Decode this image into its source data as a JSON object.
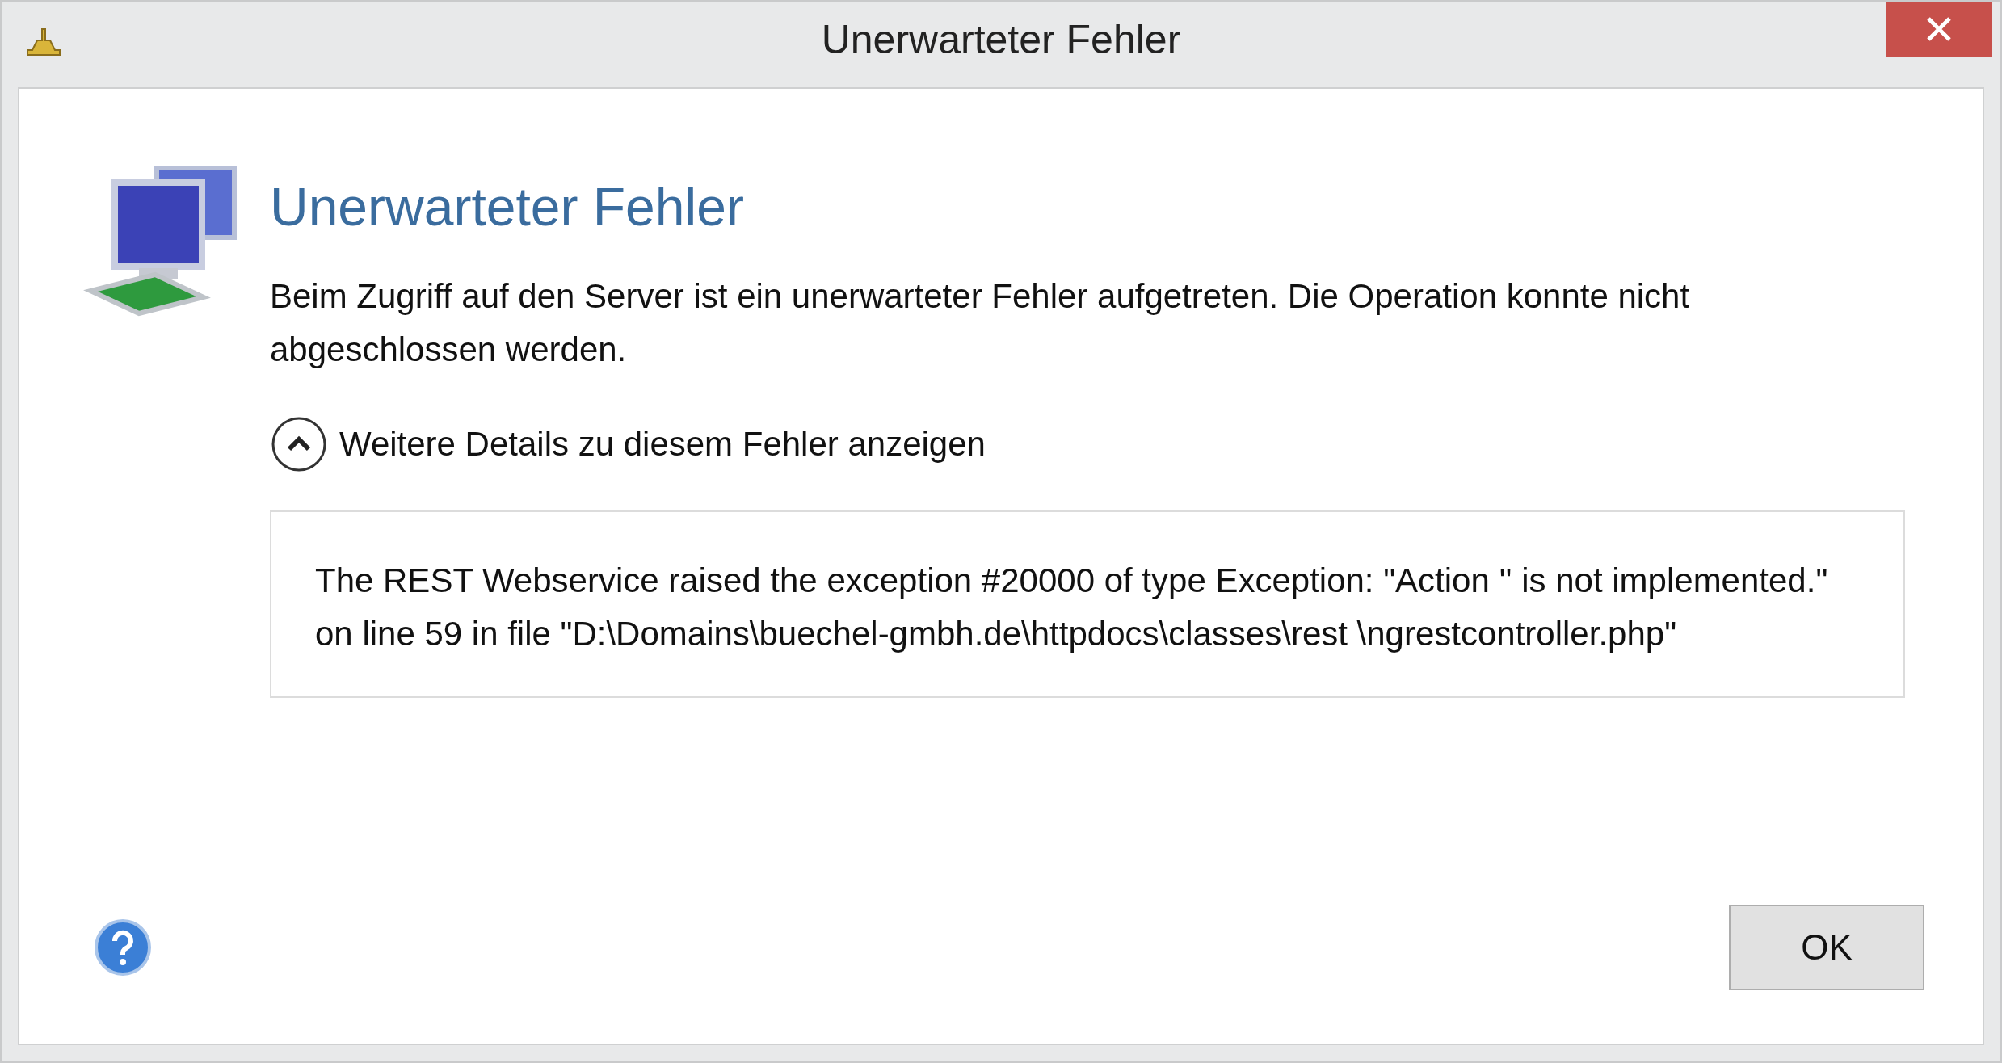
{
  "window": {
    "title": "Unerwarteter Fehler"
  },
  "heading": "Unerwarteter Fehler",
  "message": "Beim Zugriff auf den Server ist ein unerwarteter Fehler aufgetreten. Die Operation konnte nicht abgeschlossen werden.",
  "details_toggle": {
    "label": "Weitere Details zu diesem Fehler anzeigen",
    "expanded": true
  },
  "details": "The REST Webservice raised the exception #20000 of type Exception: \"Action '' is not implemented.\" on line 59 in file \"D:\\Domains\\buechel-gmbh.de\\httpdocs\\classes\\rest \\ngrestcontroller.php\"",
  "buttons": [
    "OK"
  ]
}
